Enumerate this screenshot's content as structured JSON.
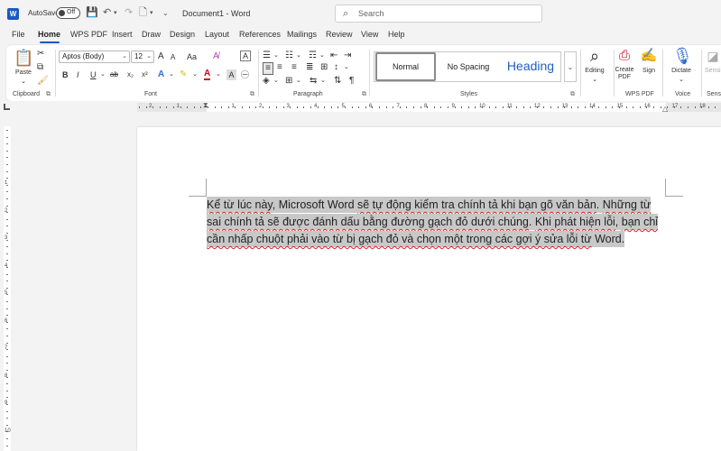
{
  "titlebar": {
    "autosave_label": "AutoSave",
    "autosave_state": "Off",
    "document_title": "Document1 - Word",
    "search_placeholder": "Search"
  },
  "menu": {
    "tabs": [
      {
        "label": "File"
      },
      {
        "label": "Home"
      },
      {
        "label": "WPS PDF"
      },
      {
        "label": "Insert"
      },
      {
        "label": "Draw"
      },
      {
        "label": "Design"
      },
      {
        "label": "Layout"
      },
      {
        "label": "References"
      },
      {
        "label": "Mailings"
      },
      {
        "label": "Review"
      },
      {
        "label": "View"
      },
      {
        "label": "Help"
      }
    ],
    "active_tab": "Home"
  },
  "ribbon": {
    "clipboard": {
      "label": "Clipboard",
      "paste_label": "Paste"
    },
    "font": {
      "label": "Font",
      "font_name": "Aptos (Body)",
      "font_size": "12",
      "bold": "B",
      "italic": "I",
      "underline": "U",
      "strike": "ab",
      "subscript": "x₂",
      "superscript": "x²",
      "grow": "A",
      "shrink": "A",
      "change_case": "Aa"
    },
    "paragraph": {
      "label": "Paragraph",
      "pilcrow": "¶"
    },
    "styles": {
      "label": "Styles",
      "items": [
        {
          "label": "Normal"
        },
        {
          "label": "No Spacing"
        },
        {
          "label": "Heading"
        }
      ]
    },
    "editing": {
      "label": "Editing"
    },
    "wps_pdf": {
      "label": "WPS PDF",
      "create_pdf": "Create PDF",
      "sign": "Sign"
    },
    "voice": {
      "label": "Voice",
      "dictate": "Dictate"
    },
    "sensitivity": {
      "label": "Sensi"
    }
  },
  "ruler": {
    "numbers": [
      "2",
      "1",
      "1",
      "2",
      "3",
      "4",
      "5",
      "6",
      "7",
      "8",
      "9",
      "10",
      "11",
      "12",
      "13",
      "14",
      "15",
      "16",
      "17",
      "18"
    ]
  },
  "vruler": {
    "numbers": [
      "1",
      "2",
      "3",
      "4",
      "5",
      "6",
      "7",
      "8",
      "9",
      "10"
    ]
  },
  "document": {
    "segments": [
      {
        "text": "Kể từ lúc này",
        "err": true
      },
      {
        "text": ", Microsoft Word ",
        "err": false
      },
      {
        "text": "sẽ tự động kiểm tra chính tả khi bạn gõ văn bản",
        "err": true
      },
      {
        "text": ". ",
        "err": false
      },
      {
        "text": "Những từ sai chính tả sẽ được đánh dấu bằng đường gạch đỏ dưới chúng",
        "err": true
      },
      {
        "text": ". ",
        "err": false
      },
      {
        "text": "Khi phát hiện lỗi",
        "err": true
      },
      {
        "text": ", ",
        "err": false
      },
      {
        "text": "bạn chỉ cần nhấp chuột phải vào từ bị gạch đỏ và chọn một trong các gợi ý sửa lỗi từ",
        "err": true
      },
      {
        "text": " Word.",
        "err": false
      }
    ]
  },
  "colors": {
    "accent": "#185abd",
    "selection": "#c8c8c8",
    "spell_error": "#e02020"
  }
}
